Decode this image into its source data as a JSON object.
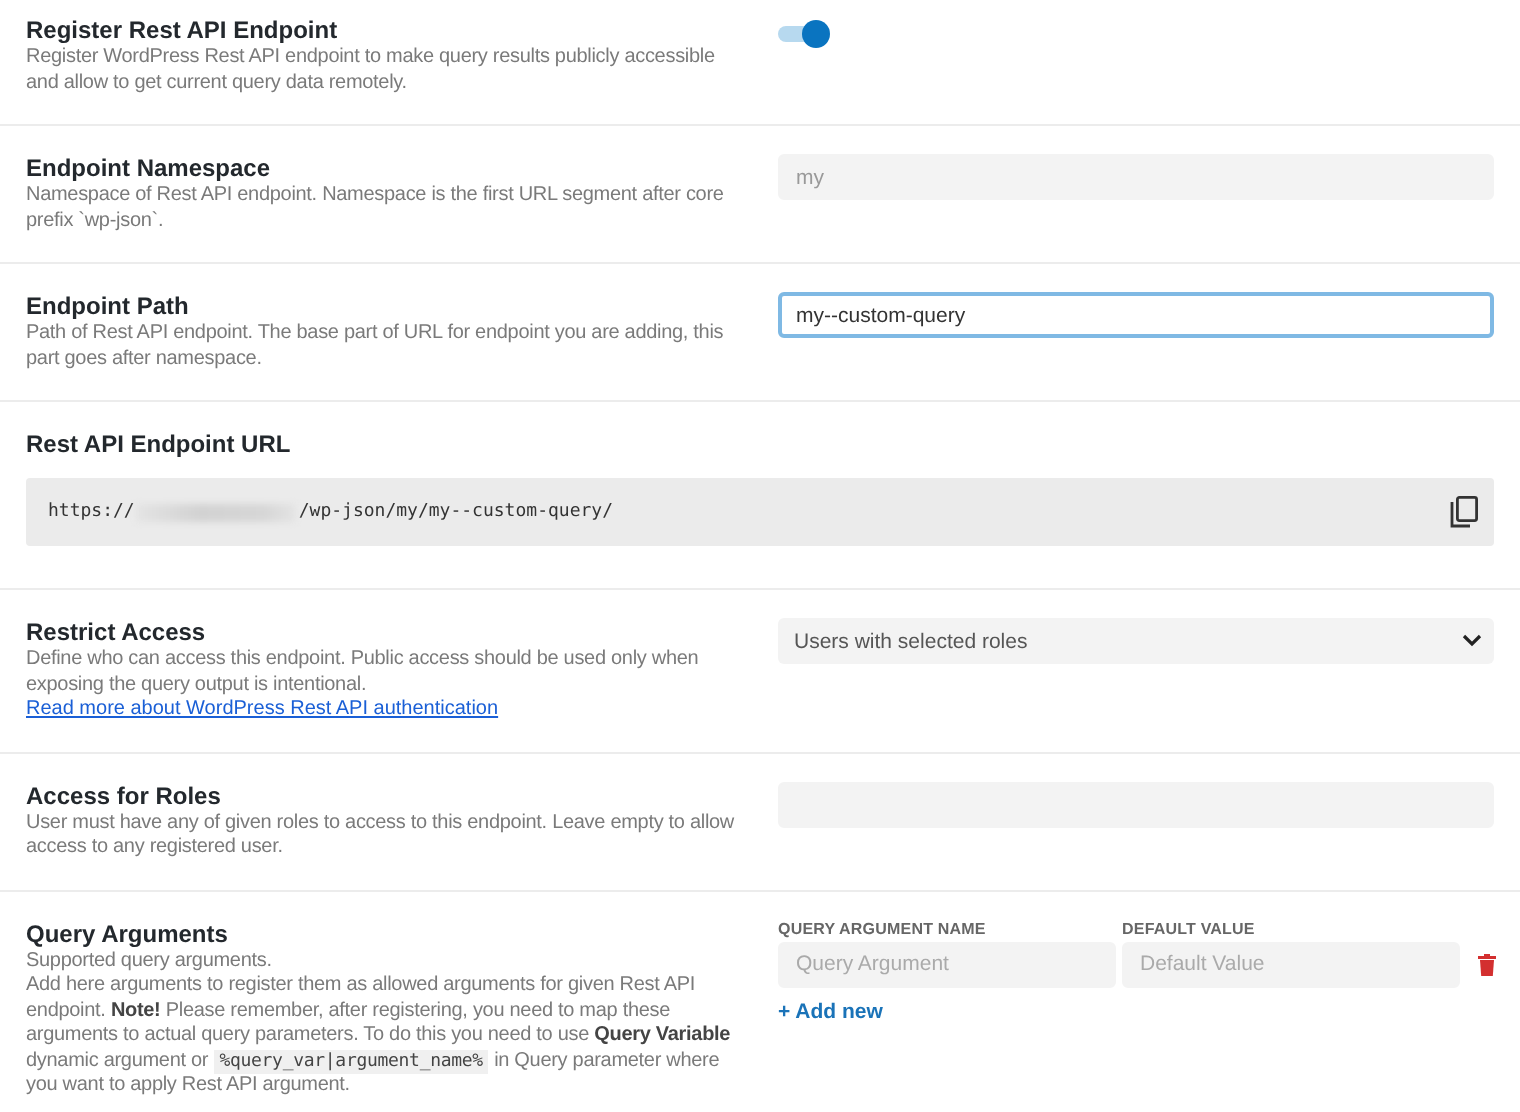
{
  "settings": [
    {
      "kind": "toggle",
      "title": "Register Rest API Endpoint",
      "description": "Register WordPress Rest API endpoint to make query results publicly accessible and allow to get current query data remotely.",
      "on": true
    },
    {
      "kind": "text",
      "title": "Endpoint Namespace",
      "description": "Namespace of Rest API endpoint. Namespace is the first URL segment after core prefix `wp-json`.",
      "placeholder": "my",
      "focused": false
    },
    {
      "kind": "text",
      "title": "Endpoint Path",
      "description": "Path of Rest API endpoint. The base part of URL for endpoint you are adding, this part goes after namespace.",
      "value": "my--custom-query",
      "focused": true
    },
    {
      "kind": "url",
      "title": "Rest API Endpoint URL",
      "url_start": "https://",
      "url_end": "/wp-json/my/my--custom-query/"
    },
    {
      "kind": "select",
      "title": "Restrict Access",
      "description": "Define who can access this endpoint. Public access should be used only when exposing the query output is intentional.",
      "link": "Read more about WordPress Rest API authentication",
      "value": "Users with selected roles"
    },
    {
      "kind": "text",
      "title": "Access for Roles",
      "description": "User must have any of given roles to access to this endpoint. Leave empty to allow access to any registered user.",
      "focused": false
    },
    {
      "kind": "arguments",
      "title": "Query Arguments",
      "description": "Supported query arguments.",
      "details": [
        {
          "kind": "text",
          "text": "Add here arguments to register them as allowed arguments for given Rest API endpoint. **Note!** Please remember, after registering, you need to map these arguments to actual query parameters. To do this you need to use **Query Variable** dynamic argument or "
        },
        {
          "kind": "code",
          "text": "%query_var|argument_name%"
        },
        {
          "kind": "text",
          "text": " in Query parameter where you want to apply Rest API argument."
        }
      ],
      "columns": [
        "QUERY ARGUMENT NAME",
        "DEFAULT VALUE"
      ],
      "rows": [
        {
          "name_placeholder": "Query Argument",
          "value_placeholder": "Default Value"
        }
      ],
      "add_label": "+ Add new"
    }
  ]
}
